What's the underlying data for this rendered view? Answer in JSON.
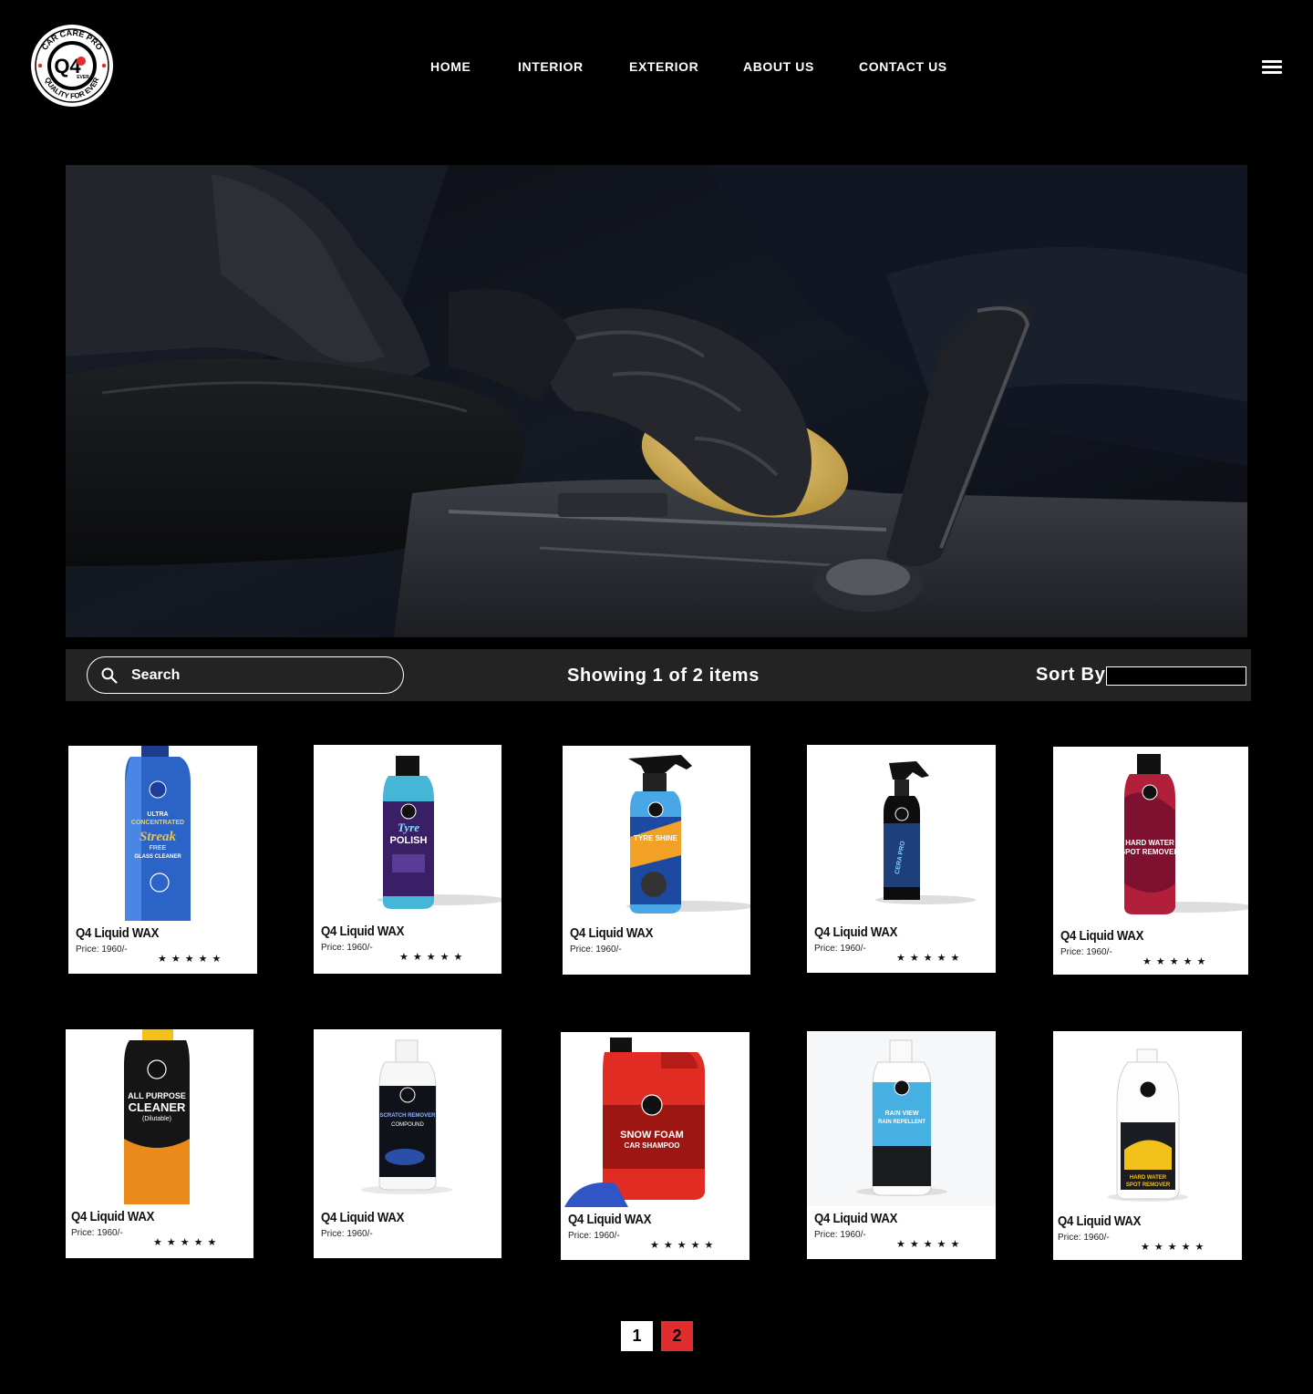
{
  "brand": {
    "logo_text": "Q4",
    "logo_ring_top": "CAR CARE PRO",
    "logo_ring_bottom": "QUALITY FOR EVER",
    "logo_sub": "EVER"
  },
  "nav": {
    "items": [
      "HOME",
      "INTERIOR",
      "EXTERIOR",
      "ABOUT US",
      "CONTACT US"
    ]
  },
  "toolbar": {
    "search_placeholder": "Search",
    "showing": "Showing 1 of 2 items",
    "sort_label": "Sort By"
  },
  "products": [
    {
      "name": "Q4 Liquid WAX",
      "price": "Price: 1960/-",
      "stars": "★★★★★",
      "product": "Streak Free Glass Cleaner"
    },
    {
      "name": "Q4 Liquid WAX",
      "price": "Price: 1960/-",
      "stars": "★★★★★",
      "product": "Tyre Polish"
    },
    {
      "name": "Q4 Liquid WAX",
      "price": "Price: 1960/-",
      "stars": "",
      "product": "Tyre Shine"
    },
    {
      "name": "Q4 Liquid WAX",
      "price": "Price: 1960/-",
      "stars": "★★★★★",
      "product": "Cera Pro"
    },
    {
      "name": "Q4 Liquid WAX",
      "price": "Price: 1960/-",
      "stars": "★★★★★",
      "product": "Hard Water Spot Remover"
    },
    {
      "name": "Q4 Liquid WAX",
      "price": "Price: 1960/-",
      "stars": "★★★★★",
      "product": "All Purpose Cleaner"
    },
    {
      "name": "Q4 Liquid WAX",
      "price": "Price: 1960/-",
      "stars": "",
      "product": "Scratch Remover Compound"
    },
    {
      "name": "Q4 Liquid WAX",
      "price": "Price: 1960/-",
      "stars": "★★★★★",
      "product": "Snow Foam Car Shampoo"
    },
    {
      "name": "Q4 Liquid WAX",
      "price": "Price: 1960/-",
      "stars": "★★★★★",
      "product": "Rain View Rain Repellent"
    },
    {
      "name": "Q4 Liquid WAX",
      "price": "Price: 1960/-",
      "stars": "★★★★★",
      "product": "Hard Water Spot Remover"
    }
  ],
  "bottle_labels": {
    "glass_1": "ULTRA",
    "glass_2": "CONCENTRATED",
    "glass_3": "Streak",
    "glass_4": "FREE",
    "glass_5": "GLASS CLEANER",
    "tyre_1": "Tyre",
    "tyre_2": "POLISH",
    "shine_1": "TYRE SHINE",
    "cera_1": "CERA PRO",
    "spot_1": "HARD WATER",
    "spot_2": "SPOT REMOVER",
    "apc_1": "ALL PURPOSE",
    "apc_2": "CLEANER",
    "apc_3": "(Dilutable)",
    "scratch_1": "SCRATCH REMOVER",
    "scratch_2": "COMPOUND",
    "foam_1": "SNOW FOAM",
    "foam_2": "CAR SHAMPOO",
    "rain_1": "RAIN VIEW",
    "rain_2": "RAIN REPELLENT",
    "hw_1": "HARD WATER",
    "hw_2": "SPOT REMOVER"
  },
  "pagination": {
    "pages": [
      "1",
      "2"
    ],
    "current": "2"
  },
  "colors": {
    "accent": "#e12d2d",
    "background": "#000000",
    "toolbar": "#232323"
  }
}
